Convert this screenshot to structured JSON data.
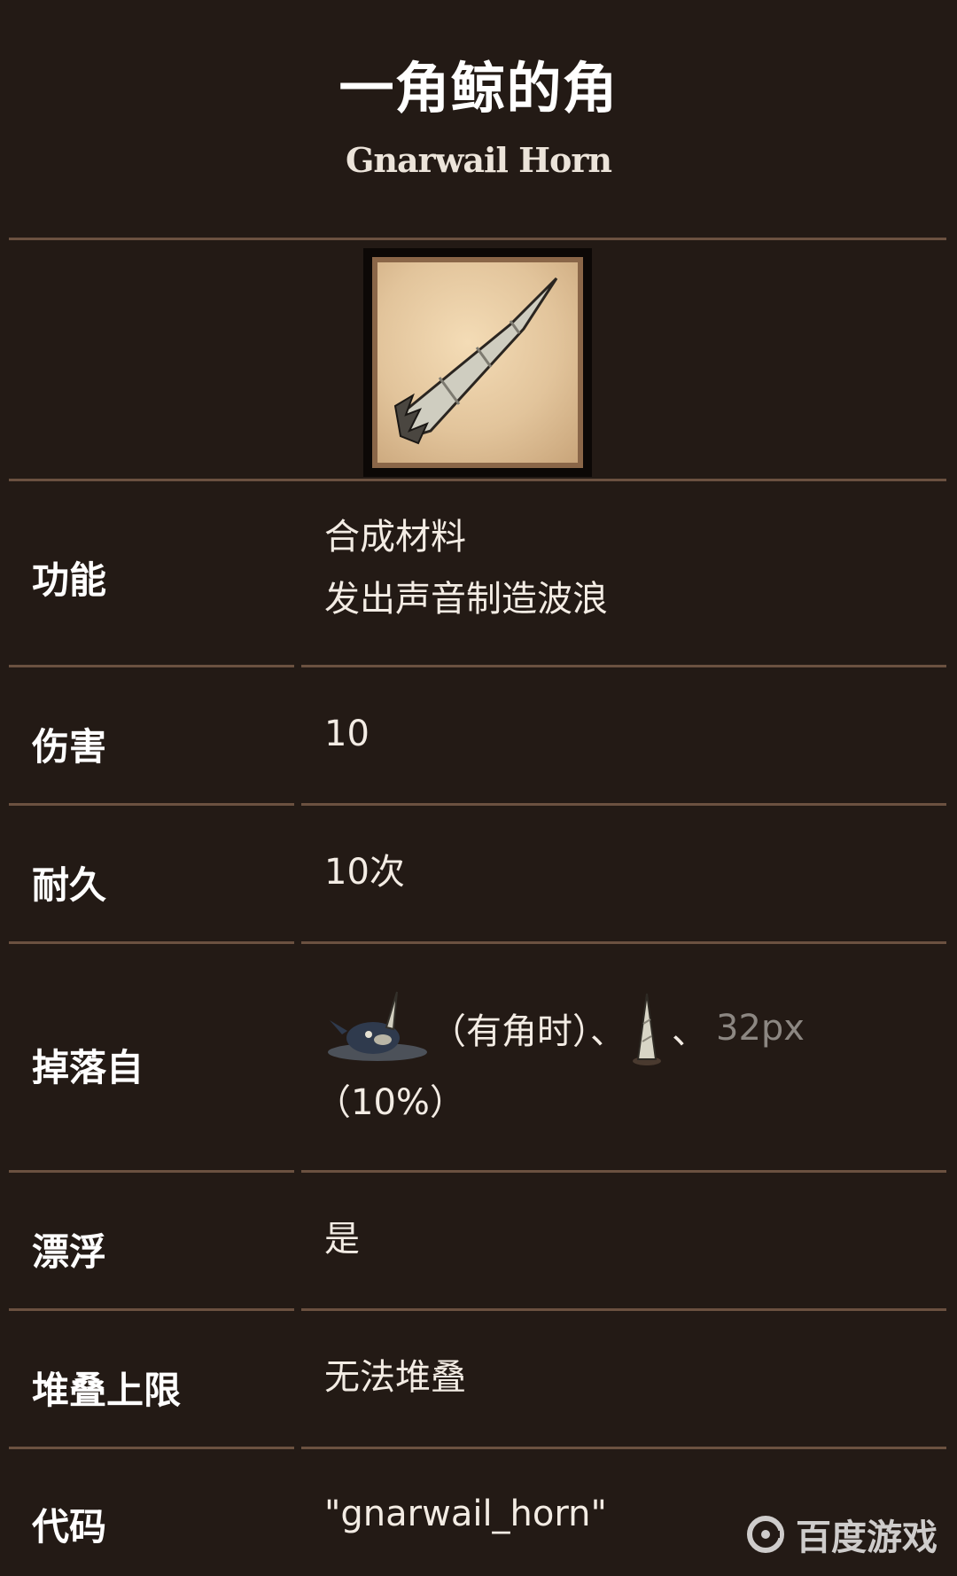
{
  "header": {
    "title_zh": "一角鲸的角",
    "title_en": "Gnarwail Horn"
  },
  "item_icon": "gnarwail-horn-icon",
  "rows": [
    {
      "label": "功能",
      "value_lines": [
        "合成材料",
        "发出声音制造波浪"
      ]
    },
    {
      "label": "伤害",
      "value": "10"
    },
    {
      "label": "耐久",
      "value": "10次"
    },
    {
      "label": "掉落自",
      "drop": {
        "source_1_icon": "gnarwail-icon",
        "source_1_note": "（有角时）、",
        "source_2_icon": "gnarwail-horn-drop-icon",
        "sep": "、",
        "placeholder": "32px",
        "chance": "（10%）"
      }
    },
    {
      "label": "漂浮",
      "value": "是"
    },
    {
      "label": "堆叠上限",
      "value": "无法堆叠"
    },
    {
      "label": "代码",
      "value": "\"gnarwail_horn\""
    }
  ],
  "watermark": "百度游戏",
  "colors": {
    "background": "#231a15",
    "divider": "#6b5140",
    "text": "#f3ece4"
  }
}
